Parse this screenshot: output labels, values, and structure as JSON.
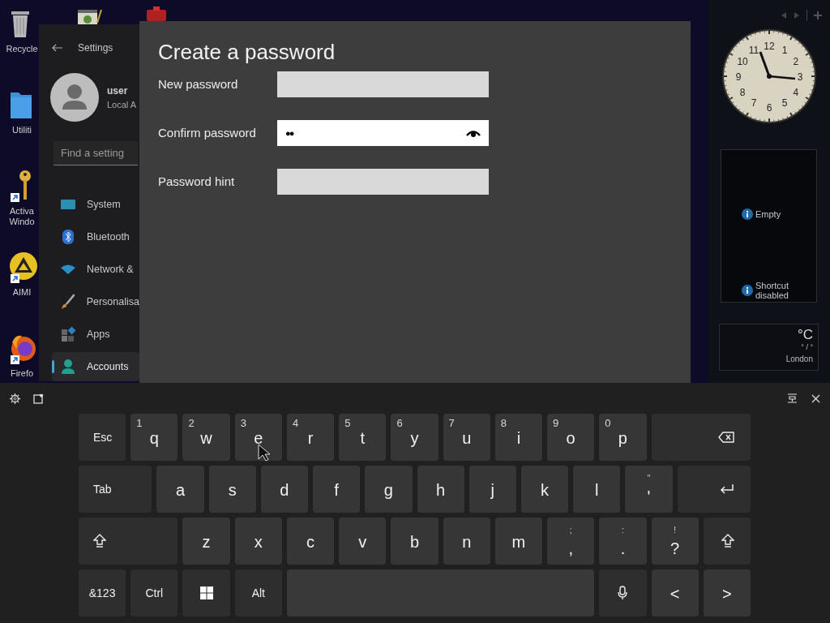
{
  "desktop_icons": [
    {
      "label": "Recycle",
      "kind": "bin",
      "shortcut": false
    },
    {
      "label": "Utiliti",
      "kind": "folder",
      "shortcut": false
    },
    {
      "label": "Activa Windo",
      "kind": "key",
      "shortcut": true
    },
    {
      "label": "AIMI",
      "kind": "player",
      "shortcut": true
    },
    {
      "label": "Firefo",
      "kind": "browser",
      "shortcut": true
    }
  ],
  "settings": {
    "title": "Settings",
    "user": {
      "name": "user",
      "account": "Local A"
    },
    "search": {
      "placeholder": "Find a setting"
    },
    "nav": [
      {
        "label": "System",
        "kind": "system",
        "selected": false
      },
      {
        "label": "Bluetooth",
        "kind": "bluetooth",
        "selected": false
      },
      {
        "label": "Network &",
        "kind": "network",
        "selected": false
      },
      {
        "label": "Personalisa",
        "kind": "brush",
        "selected": false
      },
      {
        "label": "Apps",
        "kind": "apps",
        "selected": false
      },
      {
        "label": "Accounts",
        "kind": "accounts",
        "selected": true
      }
    ]
  },
  "dialog": {
    "title": "Create a password",
    "fields": [
      {
        "label": "New password",
        "focused": false
      },
      {
        "label": "Confirm password",
        "focused": true,
        "value": "●●"
      },
      {
        "label": "Password hint",
        "focused": false
      }
    ]
  },
  "gadgets": {
    "clock": {
      "numerals": [
        "12",
        "11",
        "1",
        "10",
        "2",
        "9",
        "3",
        "8",
        "4",
        "7",
        "5",
        "6"
      ]
    },
    "slideshow": {
      "messages": [
        "Empty",
        "Shortcut disabled"
      ]
    },
    "weather": {
      "unit": "°C",
      "range": "° / °",
      "city": "London"
    }
  },
  "keyboard": {
    "rows": [
      {
        "keys": [
          {
            "kind": "text",
            "label": "Esc"
          },
          {
            "kind": "char",
            "label": "q",
            "number": "1"
          },
          {
            "kind": "char",
            "label": "w",
            "number": "2"
          },
          {
            "kind": "char",
            "label": "e",
            "number": "3"
          },
          {
            "kind": "char",
            "label": "r",
            "number": "4"
          },
          {
            "kind": "char",
            "label": "t",
            "number": "5"
          },
          {
            "kind": "char",
            "label": "y",
            "number": "6"
          },
          {
            "kind": "char",
            "label": "u",
            "number": "7"
          },
          {
            "kind": "char",
            "label": "i",
            "number": "8"
          },
          {
            "kind": "char",
            "label": "o",
            "number": "9"
          },
          {
            "kind": "char",
            "label": "p",
            "number": "0"
          },
          {
            "kind": "backspace"
          }
        ]
      },
      {
        "keys": [
          {
            "kind": "text",
            "label": "Tab"
          },
          {
            "kind": "char",
            "label": "a"
          },
          {
            "kind": "char",
            "label": "s"
          },
          {
            "kind": "char",
            "label": "d"
          },
          {
            "kind": "char",
            "label": "f"
          },
          {
            "kind": "char",
            "label": "g"
          },
          {
            "kind": "char",
            "label": "h"
          },
          {
            "kind": "char",
            "label": "j"
          },
          {
            "kind": "char",
            "label": "k"
          },
          {
            "kind": "char",
            "label": "l"
          },
          {
            "kind": "char",
            "label": "'",
            "symbol": "\""
          },
          {
            "kind": "enter"
          }
        ]
      },
      {
        "keys": [
          {
            "kind": "shift"
          },
          {
            "kind": "char",
            "label": "z"
          },
          {
            "kind": "char",
            "label": "x"
          },
          {
            "kind": "char",
            "label": "c"
          },
          {
            "kind": "char",
            "label": "v"
          },
          {
            "kind": "char",
            "label": "b"
          },
          {
            "kind": "char",
            "label": "n"
          },
          {
            "kind": "char",
            "label": "m"
          },
          {
            "kind": "char",
            "label": ",",
            "symbol": ";"
          },
          {
            "kind": "char",
            "label": ".",
            "symbol": ":"
          },
          {
            "kind": "char",
            "label": "?",
            "symbol": "!"
          },
          {
            "kind": "shift"
          }
        ]
      },
      {
        "keys": [
          {
            "kind": "text",
            "label": "&123"
          },
          {
            "kind": "text",
            "label": "Ctrl"
          },
          {
            "kind": "windows"
          },
          {
            "kind": "text",
            "label": "Alt"
          },
          {
            "kind": "space"
          },
          {
            "kind": "mic"
          },
          {
            "kind": "char",
            "label": "<"
          },
          {
            "kind": "char",
            "label": ">"
          }
        ]
      }
    ]
  }
}
